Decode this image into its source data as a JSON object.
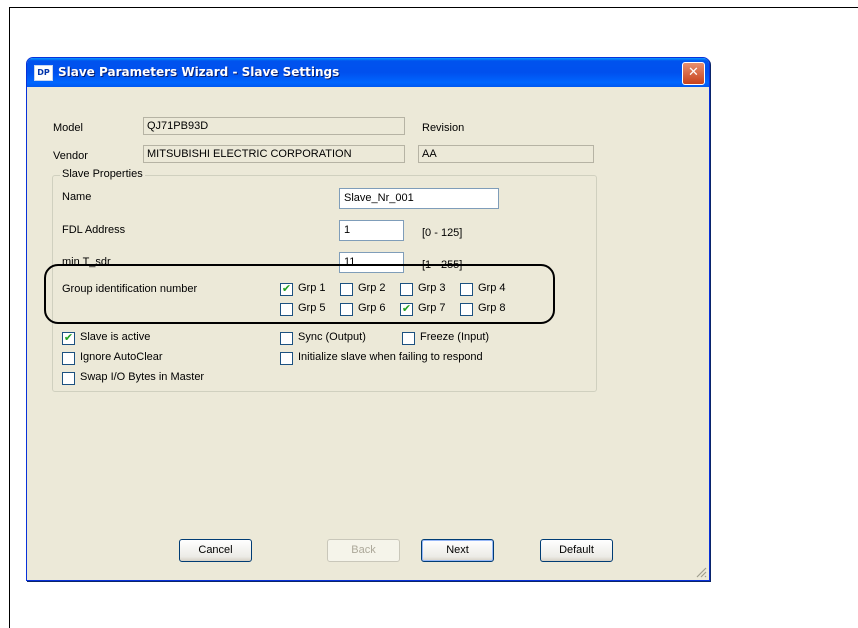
{
  "window": {
    "icon_text": "DP",
    "title": "Slave Parameters Wizard - Slave Settings",
    "close_glyph": "✕"
  },
  "device": {
    "model_label": "Model",
    "model_value": "QJ71PB93D",
    "revision_label": "Revision",
    "vendor_label": "Vendor",
    "vendor_value": "MITSUBISHI ELECTRIC CORPORATION",
    "revision_value": "AA"
  },
  "slave_properties": {
    "legend": "Slave Properties",
    "name_label": "Name",
    "name_value": "Slave_Nr_001",
    "fdl_label": "FDL Address",
    "fdl_value": "1",
    "fdl_range": "[0 - 125]",
    "tsdr_label": "min T_sdr",
    "tsdr_value": "11",
    "tsdr_range": "[1 - 255]",
    "group_label": "Group identification number",
    "groups": [
      {
        "label": "Grp 1",
        "checked": true
      },
      {
        "label": "Grp 2",
        "checked": false
      },
      {
        "label": "Grp 3",
        "checked": false
      },
      {
        "label": "Grp 4",
        "checked": false
      },
      {
        "label": "Grp 5",
        "checked": false
      },
      {
        "label": "Grp 6",
        "checked": false
      },
      {
        "label": "Grp 7",
        "checked": true
      },
      {
        "label": "Grp 8",
        "checked": false
      }
    ],
    "options": [
      {
        "label": "Slave is active",
        "checked": true
      },
      {
        "label": "Sync (Output)",
        "checked": false
      },
      {
        "label": "Freeze (Input)",
        "checked": false
      },
      {
        "label": "Ignore AutoClear",
        "checked": false
      },
      {
        "label": "Initialize slave when failing to respond",
        "checked": false
      },
      {
        "label": "Swap I/O Bytes in Master",
        "checked": false
      }
    ]
  },
  "buttons": {
    "cancel": "Cancel",
    "back": "Back",
    "next": "Next",
    "default": "Default"
  },
  "check_glyph": "✔"
}
